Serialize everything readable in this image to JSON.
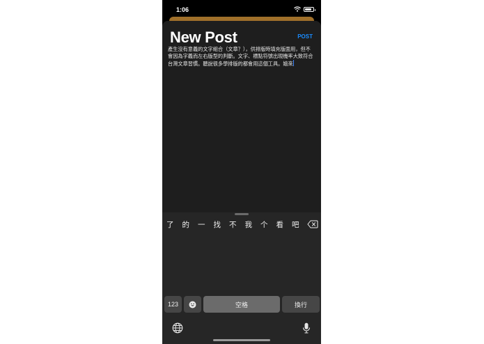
{
  "status_bar": {
    "time": "1:06"
  },
  "header": {
    "title": "New Post",
    "post_label": "POST",
    "accent_color": "#1a8cff"
  },
  "editor": {
    "text": "產生沒有意義的文字組合（文章？），供排版時填充版面用，但不會因為字義而左右版型的判斷。文字、標點符號出現機率大致符合台灣文章習慣。聽說很多學排版的都會用這個工具。嬉來"
  },
  "keyboard": {
    "candidates": [
      "了",
      "的",
      "一",
      "找",
      "不",
      "我",
      "个",
      "看",
      "吧"
    ],
    "key_123": "123",
    "space_label": "空格",
    "return_label": "換行",
    "icons": [
      "delete-icon",
      "emoji-icon",
      "globe-icon",
      "microphone-icon"
    ]
  }
}
